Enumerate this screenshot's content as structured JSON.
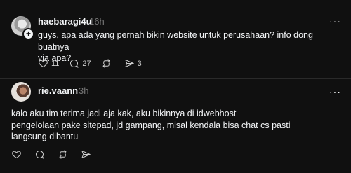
{
  "posts": [
    {
      "username": "haebaragi4u",
      "time": "16h",
      "text_lines": [
        "guys, apa ada yang pernah bikin website untuk perusahaan? info dong buatnya",
        "via apa?"
      ],
      "counts": {
        "likes": "11",
        "replies": "27",
        "reposts": "",
        "shares": "3"
      },
      "more": "···",
      "follow_badge": "+"
    },
    {
      "username": "rie.vaann",
      "time": "3h",
      "text_lines": [
        "kalo aku tim terima jadi aja kak, aku bikinnya di idwebhost",
        "pengelolaan pake sitepad, jd gampang, misal kendala bisa chat cs pasti",
        "langsung dibantu"
      ],
      "counts": {
        "likes": "",
        "replies": "",
        "reposts": "",
        "shares": ""
      },
      "more": "···"
    }
  ],
  "icons": [
    "heart-icon",
    "comment-icon",
    "repost-icon",
    "share-icon",
    "more-icon",
    "follow-plus-icon"
  ],
  "colors": {
    "background": "#101010",
    "text": "#f3f5f7",
    "muted": "#777777",
    "divider": "#2a2a2a"
  }
}
